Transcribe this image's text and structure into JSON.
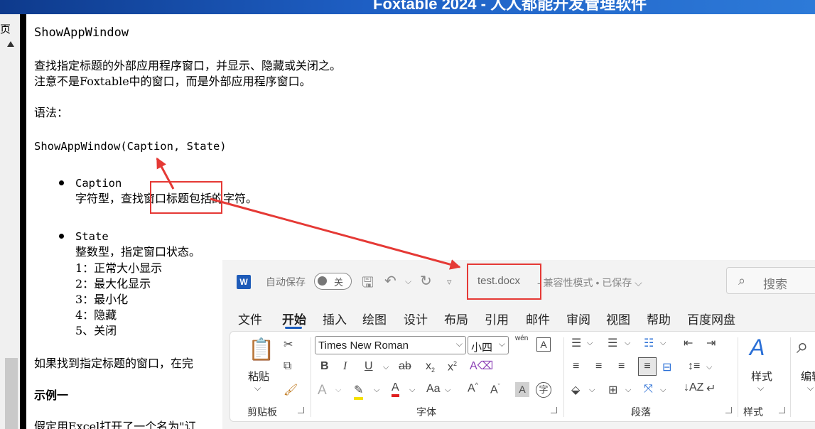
{
  "banner": {
    "text": "Foxtable 2024 - 人人都能开发管理软件"
  },
  "left_pane": {
    "label": "页"
  },
  "doc": {
    "heading": "ShowAppWindow",
    "desc1": "查找指定标题的外部应用程序窗口，并显示、隐藏或关闭之。",
    "desc2": "注意不是Foxtable中的窗口，而是外部应用程序窗口。",
    "syntax_label": "语法：",
    "syntax": "ShowAppWindow(Caption, State)",
    "params": [
      {
        "name": "Caption",
        "desc": "字符型，查找窗口标题包括的字符。"
      },
      {
        "name": "State",
        "desc": "整数型，指定窗口状态。"
      }
    ],
    "states": [
      "1：正常大小显示",
      "2：最大化显示",
      "3：最小化",
      "4：隐藏",
      "5、关闭"
    ],
    "found_text": "如果找到指定标题的窗口，在完",
    "example_heading": "示例一",
    "example_text": "假定用Excel打开了一个名为\"订"
  },
  "word": {
    "logo": "W",
    "autosave_label": "自动保存",
    "autosave_state": "关",
    "doc_title": "test.docx",
    "compat_status": "- 兼容性模式 • 已保存 ⌵",
    "search_placeholder": "搜索",
    "tabs": [
      "文件",
      "开始",
      "插入",
      "绘图",
      "设计",
      "布局",
      "引用",
      "邮件",
      "审阅",
      "视图",
      "帮助",
      "百度网盘"
    ],
    "active_tab": "开始",
    "ribbon": {
      "paste_label": "粘贴",
      "font_name": "Times New Roman",
      "font_size": "小四",
      "phonetic": "wén",
      "styles_label": "样式",
      "edit_label": "编辑",
      "groups": [
        "剪贴板",
        "字体",
        "段落",
        "样式"
      ]
    }
  }
}
